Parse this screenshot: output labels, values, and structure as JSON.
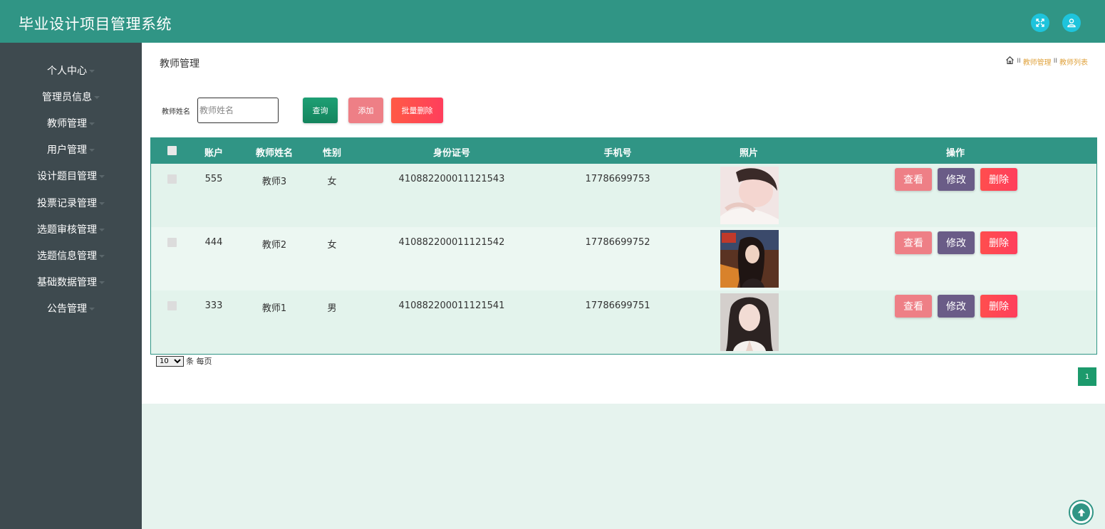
{
  "header": {
    "title": "毕业设计项目管理系统",
    "accent": "#309585"
  },
  "sidebar": {
    "items": [
      {
        "label": "个人中心"
      },
      {
        "label": "管理员信息"
      },
      {
        "label": "教师管理"
      },
      {
        "label": "用户管理"
      },
      {
        "label": "设计题目管理"
      },
      {
        "label": "投票记录管理"
      },
      {
        "label": "选题审核管理"
      },
      {
        "label": "选题信息管理"
      },
      {
        "label": "基础数据管理"
      },
      {
        "label": "公告管理"
      }
    ]
  },
  "page": {
    "title": "教师管理",
    "breadcrumb": {
      "sep": "II",
      "items": [
        "教师管理",
        "教师列表"
      ]
    }
  },
  "search": {
    "label": "教师姓名",
    "placeholder": "教师姓名",
    "value": ""
  },
  "buttons": {
    "query": "查询",
    "add": "添加",
    "batch_delete": "批量删除"
  },
  "table": {
    "headers": {
      "account": "账户",
      "name": "教师姓名",
      "gender": "性别",
      "id_card": "身份证号",
      "phone": "手机号",
      "photo": "照片",
      "actions": "操作"
    },
    "rows": [
      {
        "account": "555",
        "name": "教师3",
        "gender": "女",
        "id_card": "410882200011121543",
        "phone": "17786699753"
      },
      {
        "account": "444",
        "name": "教师2",
        "gender": "女",
        "id_card": "410882200011121542",
        "phone": "17786699752"
      },
      {
        "account": "333",
        "name": "教师1",
        "gender": "男",
        "id_card": "410882200011121541",
        "phone": "17786699751"
      }
    ],
    "actions": {
      "view": "查看",
      "edit": "修改",
      "delete": "删除"
    }
  },
  "pagination": {
    "page_size": "10",
    "page_size_suffix": "条 每页",
    "current_page": "1"
  },
  "icons": {
    "fullscreen": "fullscreen-icon",
    "user": "user-icon",
    "home": "home-icon",
    "back_to_top": "arrow-up-icon"
  }
}
